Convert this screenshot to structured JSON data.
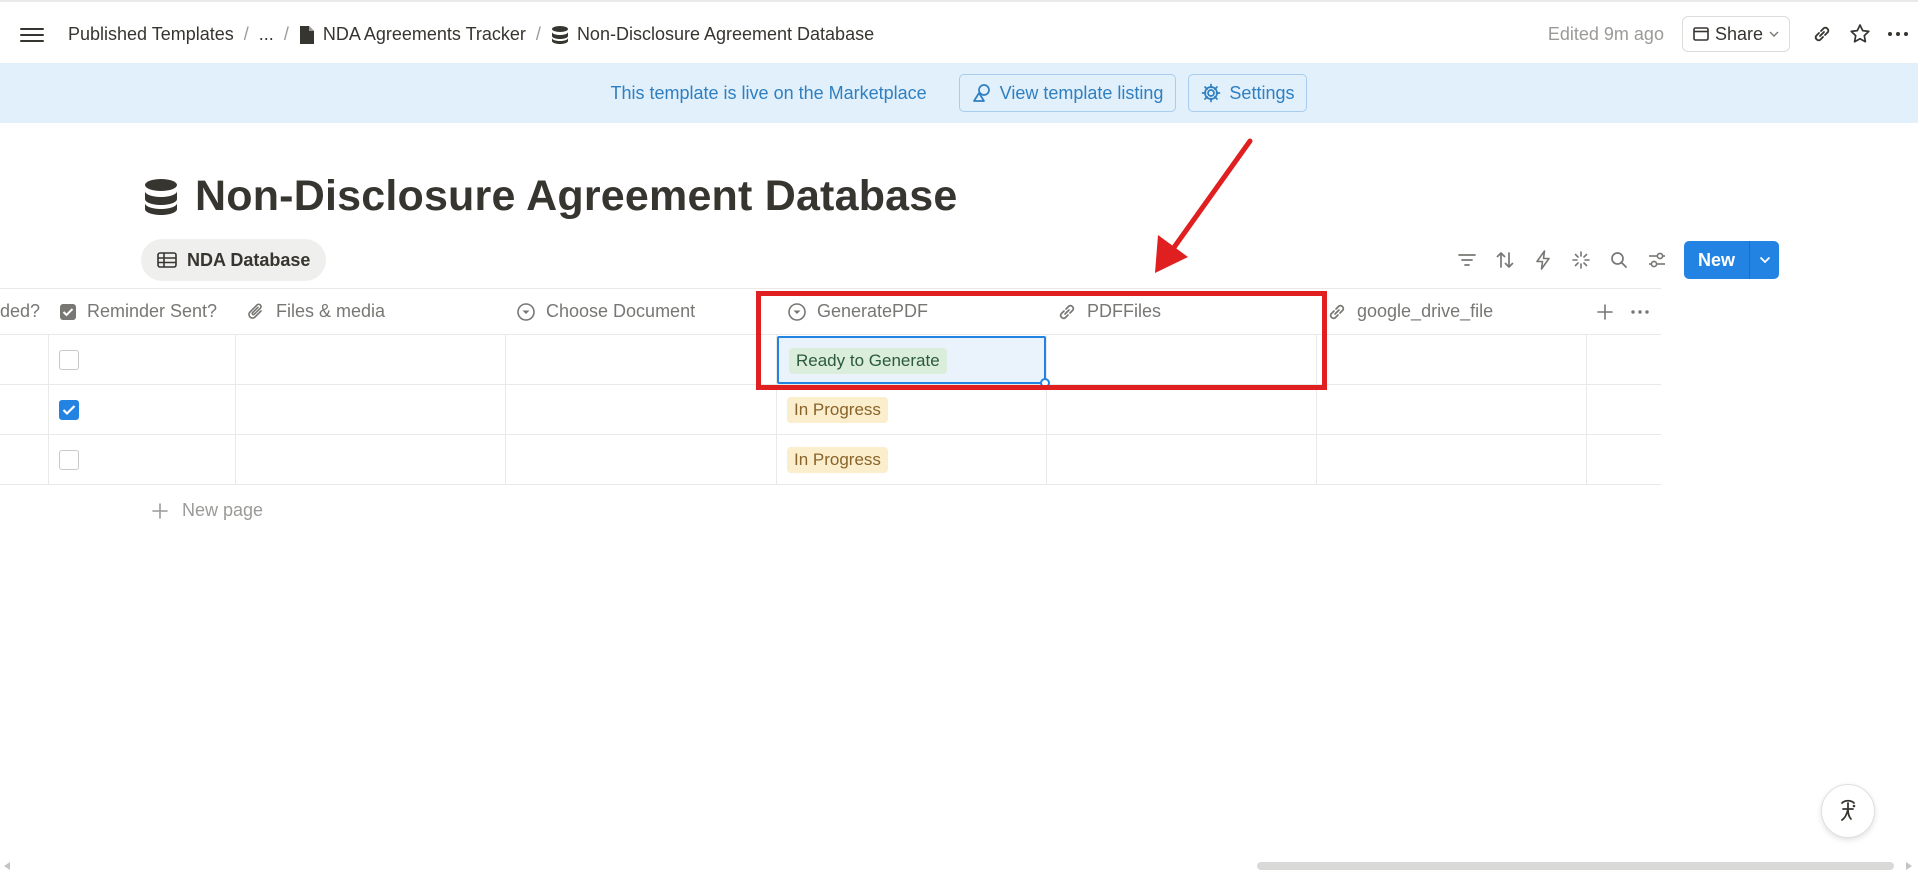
{
  "breadcrumb": {
    "items": [
      "Published Templates",
      "...",
      "NDA Agreements Tracker",
      "Non-Disclosure Agreement Database"
    ],
    "separator": "/"
  },
  "header": {
    "edited": "Edited 9m ago",
    "share_label": "Share"
  },
  "banner": {
    "text": "This template is live on the Marketplace",
    "view_listing_label": "View template listing",
    "settings_label": "Settings"
  },
  "page": {
    "title": "Non-Disclosure Agreement Database",
    "view_tab_label": "NDA Database"
  },
  "toolbar": {
    "new_label": "New",
    "icons": [
      "filter-icon",
      "sort-icon",
      "lightning-icon",
      "sparkle-icon",
      "search-icon",
      "settings-sliders-icon"
    ]
  },
  "table": {
    "columns": [
      "ded?",
      "Reminder Sent?",
      "Files & media",
      "Choose Document",
      "GeneratePDF",
      "PDFFiles",
      "google_drive_file"
    ],
    "rows": [
      {
        "reminder_sent": false,
        "generate_pdf": "Ready to Generate"
      },
      {
        "reminder_sent": true,
        "generate_pdf": "In Progress"
      },
      {
        "reminder_sent": false,
        "generate_pdf": "In Progress"
      }
    ],
    "new_page_label": "New page"
  },
  "colors": {
    "accent": "#2383e2",
    "banner_bg": "#e1f0fb",
    "banner_text": "#2f7fc1",
    "annotation": "#e02020",
    "tag_ready_bg": "#dbeddb",
    "tag_progress_bg": "#fbeecd"
  }
}
